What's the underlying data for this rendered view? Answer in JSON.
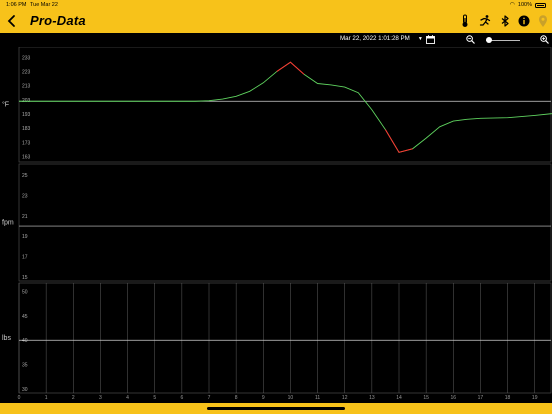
{
  "status_bar": {
    "time": "1:06 PM",
    "date": "Tue Mar 22",
    "battery": "100%"
  },
  "header": {
    "title": "Pro-Data",
    "icons": [
      "back-icon",
      "thermometer-icon",
      "runner-icon",
      "bluetooth-icon",
      "info-icon",
      "location-pin-icon"
    ],
    "accent_color": "#f7c21a"
  },
  "toolbar": {
    "selected_date": "Mar 22, 2022 1:01:28 PM",
    "icons": [
      "calendar-icon",
      "zoom-out-icon",
      "zoom-in-icon"
    ]
  },
  "chart_data": [
    {
      "type": "line",
      "ylabel": "°F",
      "yticks": [
        163,
        173,
        183,
        193,
        203,
        213,
        223,
        233
      ],
      "ylim": [
        162,
        236
      ],
      "xlim": [
        0,
        19.6
      ],
      "reference_line": 202,
      "grid": false,
      "series": [
        {
          "color": "#5fd35f",
          "points": [
            [
              0,
              202
            ],
            [
              6.5,
              202
            ],
            [
              7,
              202.4
            ],
            [
              7.5,
              203.5
            ],
            [
              8,
              205.5
            ],
            [
              8.5,
              209
            ],
            [
              9,
              215
            ],
            [
              9.5,
              223
            ],
            [
              10,
              229.5
            ],
            [
              10.5,
              221
            ],
            [
              11,
              214.5
            ],
            [
              11.5,
              213.5
            ],
            [
              12,
              212
            ],
            [
              12.5,
              208
            ],
            [
              13,
              196
            ],
            [
              13.5,
              182
            ],
            [
              14,
              166
            ],
            [
              14.5,
              168.5
            ],
            [
              15,
              176
            ],
            [
              15.5,
              184
            ],
            [
              16,
              188
            ],
            [
              16.5,
              189.3
            ],
            [
              17,
              190
            ],
            [
              18,
              190.4
            ],
            [
              19,
              192
            ],
            [
              20,
              194
            ],
            [
              20.5,
              195.5
            ],
            [
              21,
              197
            ],
            [
              22,
              198.2
            ],
            [
              23,
              198.8
            ],
            [
              24,
              199.2
            ]
          ]
        }
      ],
      "highlight_segments": [
        {
          "color": "#ff3030",
          "x": [
            9.5,
            10.5
          ]
        },
        {
          "color": "#ff3030",
          "x": [
            13.5,
            14.5
          ]
        }
      ]
    },
    {
      "type": "line",
      "ylabel": "fpm",
      "yticks": [
        15,
        17,
        19,
        21,
        23,
        25
      ],
      "ylim": [
        15,
        25.5
      ],
      "xlim": [
        0,
        19.6
      ],
      "reference_line": 20,
      "grid": false,
      "series": [
        {
          "color": "#5fd35f",
          "points": [
            [
              0,
              20
            ],
            [
              24,
              20
            ]
          ]
        }
      ]
    },
    {
      "type": "line",
      "ylabel": "lbs",
      "yticks": [
        30,
        35,
        40,
        45,
        50
      ],
      "ylim": [
        30,
        50.5
      ],
      "xlim": [
        0,
        19.6
      ],
      "xticks": [
        0,
        1,
        2,
        3,
        4,
        5,
        6,
        7,
        8,
        9,
        10,
        11,
        12,
        13,
        14,
        15,
        16,
        17,
        18,
        19
      ],
      "reference_line": 40,
      "grid": true,
      "series": [
        {
          "color": "#5fd35f",
          "points": [
            [
              0,
              40
            ],
            [
              24,
              40
            ]
          ]
        }
      ]
    }
  ]
}
